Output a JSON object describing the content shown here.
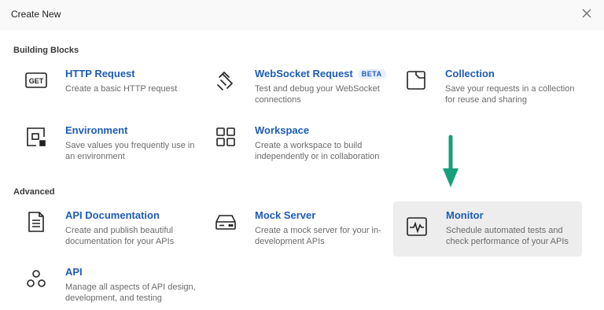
{
  "dialog": {
    "title": "Create New",
    "close_icon": "close-icon"
  },
  "sections": {
    "building_blocks": "Building Blocks",
    "advanced": "Advanced"
  },
  "items": {
    "http_request": {
      "title": "HTTP Request",
      "desc": "Create a basic HTTP request",
      "icon": "get-icon",
      "icon_text": "GET"
    },
    "websocket": {
      "title": "WebSocket Request",
      "badge": "BETA",
      "desc": "Test and debug your WebSocket connections",
      "icon": "websocket-icon"
    },
    "collection": {
      "title": "Collection",
      "desc": "Save your requests in a collection for reuse and sharing",
      "icon": "collection-icon"
    },
    "environment": {
      "title": "Environment",
      "desc": "Save values you frequently use in an environment",
      "icon": "environment-icon"
    },
    "workspace": {
      "title": "Workspace",
      "desc": "Create a workspace to build independently or in collaboration",
      "icon": "workspace-icon"
    },
    "api_documentation": {
      "title": "API Documentation",
      "desc": "Create and publish beautiful documentation for your APIs",
      "icon": "document-icon"
    },
    "mock_server": {
      "title": "Mock Server",
      "desc": "Create a mock server for your in-development APIs",
      "icon": "server-icon"
    },
    "monitor": {
      "title": "Monitor",
      "desc": "Schedule automated tests and check performance of your APIs",
      "icon": "monitor-icon"
    },
    "api": {
      "title": "API",
      "desc": "Manage all aspects of API design, development, and testing",
      "icon": "api-icon"
    }
  },
  "colors": {
    "accent": "#1d5bb8",
    "arrow": "#16a07a",
    "highlight_bg": "#ededed"
  }
}
